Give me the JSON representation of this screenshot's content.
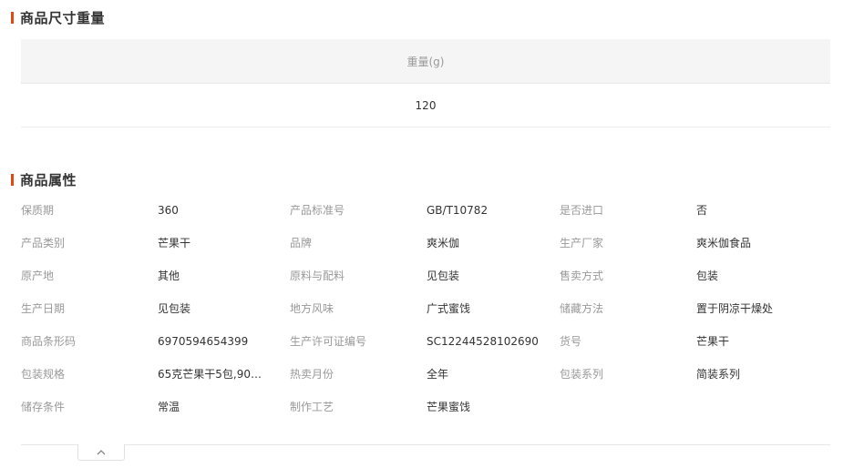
{
  "size_weight": {
    "title": "商品尺寸重量",
    "column_header": "重量(g)",
    "value": "120"
  },
  "attributes": {
    "title": "商品属性",
    "rows": [
      [
        {
          "label": "保质期",
          "value": "360"
        },
        {
          "label": "产品标准号",
          "value": "GB/T10782"
        },
        {
          "label": "是否进口",
          "value": "否"
        }
      ],
      [
        {
          "label": "产品类别",
          "value": "芒果干"
        },
        {
          "label": "品牌",
          "value": "爽米伽"
        },
        {
          "label": "生产厂家",
          "value": "爽米伽食品"
        }
      ],
      [
        {
          "label": "原产地",
          "value": "其他"
        },
        {
          "label": "原料与配料",
          "value": "见包装"
        },
        {
          "label": "售卖方式",
          "value": "包装"
        }
      ],
      [
        {
          "label": "生产日期",
          "value": "见包装"
        },
        {
          "label": "地方风味",
          "value": "广式蜜饯"
        },
        {
          "label": "储藏方法",
          "value": "置于阴凉干燥处"
        }
      ],
      [
        {
          "label": "商品条形码",
          "value": "6970594654399"
        },
        {
          "label": "生产许可证编号",
          "value": "SC12244528102690"
        },
        {
          "label": "货号",
          "value": "芒果干"
        }
      ],
      [
        {
          "label": "包装规格",
          "value": "65克芒果干5包,90克..."
        },
        {
          "label": "热卖月份",
          "value": "全年"
        },
        {
          "label": "包装系列",
          "value": "简装系列"
        }
      ],
      [
        {
          "label": "储存条件",
          "value": "常温"
        },
        {
          "label": "制作工艺",
          "value": "芒果蜜饯"
        }
      ]
    ]
  },
  "collapse_toggle": {
    "icon": "chevron-up-icon"
  },
  "colors": {
    "accent": "#e4480f",
    "label": "#999999",
    "value": "#333333",
    "header_bg": "#f5f5f5"
  }
}
